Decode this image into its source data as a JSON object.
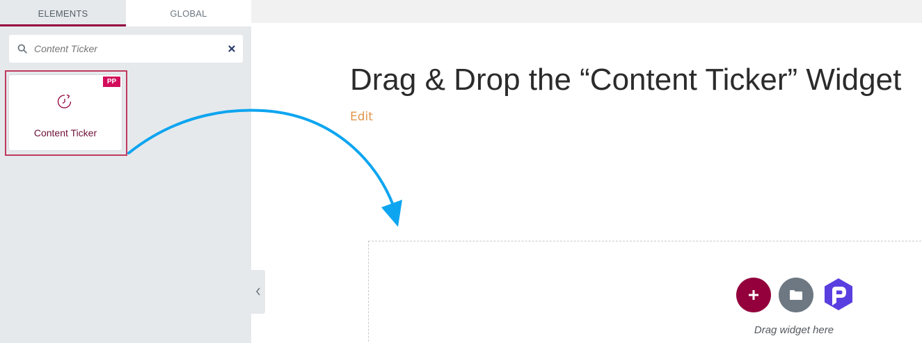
{
  "sidebar": {
    "tabs": [
      {
        "label": "ELEMENTS",
        "active": true
      },
      {
        "label": "GLOBAL",
        "active": false
      }
    ],
    "search": {
      "placeholder": "Content Ticker",
      "icon": "search-icon",
      "clear_icon": "close-icon"
    },
    "widget": {
      "label": "Content Ticker",
      "badge": "PP",
      "icon": "clock-refresh-icon"
    },
    "collapse_icon": "chevron-left-icon"
  },
  "main": {
    "heading": "Drag & Drop the “Content Ticker” Widget",
    "edit_label": "Edit",
    "drop_zone": {
      "hint": "Drag widget here",
      "buttons": [
        "plus-icon",
        "folder-icon",
        "powerpack-logo-icon"
      ]
    }
  },
  "colors": {
    "accent": "#93003c",
    "badge": "#d30c5c",
    "arrow": "#0ea5f0",
    "edit": "#e0944a",
    "sidebar_bg": "#e6e9ec",
    "pp_logo": "#5a3fe0"
  }
}
